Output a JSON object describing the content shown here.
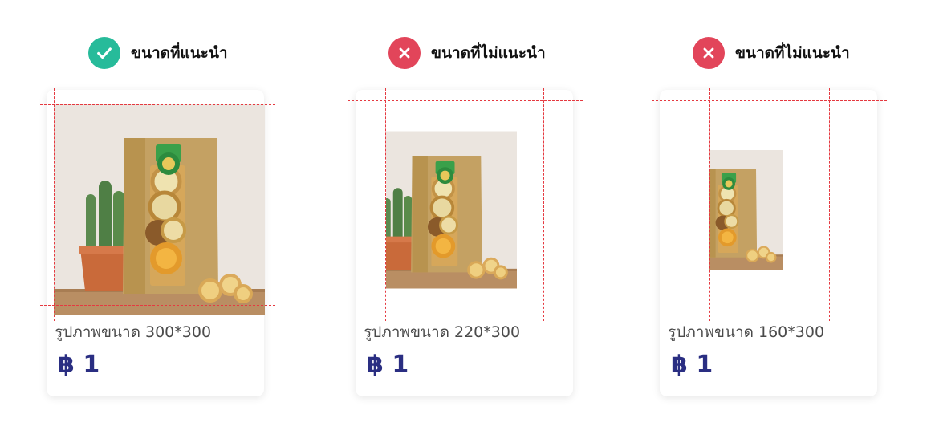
{
  "panels": [
    {
      "status": "recommended",
      "icon": "check-icon",
      "header_label": "ขนาดที่แนะนำ",
      "caption": "รูปภาพขนาด 300*300",
      "price": "฿ 1"
    },
    {
      "status": "not-recommended",
      "icon": "close-icon",
      "header_label": "ขนาดที่ไม่แนะนำ",
      "caption": "รูปภาพขนาด 220*300",
      "price": "฿ 1"
    },
    {
      "status": "not-recommended",
      "icon": "close-icon",
      "header_label": "ขนาดที่ไม่แนะนำ",
      "caption": "รูปภาพขนาด 160*300",
      "price": "฿ 1"
    }
  ],
  "colors": {
    "recommended": "#27bb9a",
    "not_recommended": "#e2455a",
    "price": "#2a2e82",
    "guide": "#e53940"
  }
}
